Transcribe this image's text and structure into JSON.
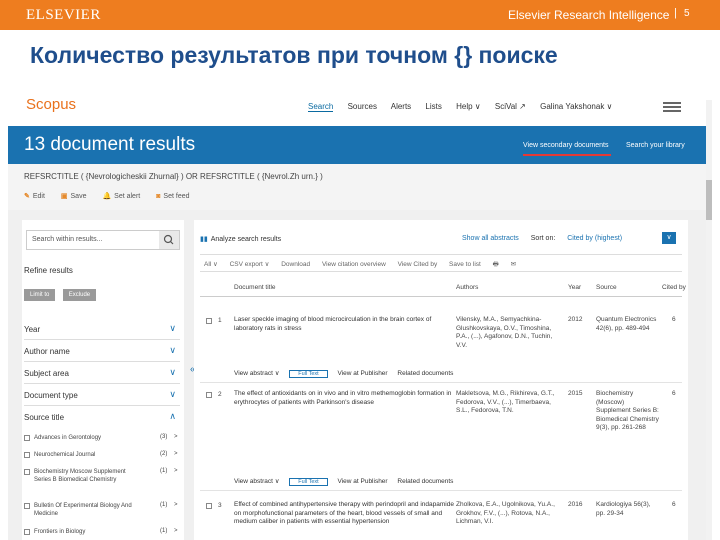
{
  "slide": {
    "title": "Количество результатов при точном {} поиске",
    "publisher_logo": "ELSEVIER",
    "product": "Elsevier Research Intelligence",
    "separator": "|",
    "page_number": "5"
  },
  "scopus": {
    "logo": "Scopus",
    "nav": [
      "Search",
      "Sources",
      "Alerts",
      "Lists",
      "Help ∨",
      "SciVal ↗",
      "Galina Yakshonak ∨"
    ],
    "menu_icon": "hamburger-icon"
  },
  "results": {
    "count_text": "13 document results",
    "view_secondary": "View secondary documents",
    "search_library": "Search your library",
    "query": "REFSRCTITLE ( {Nevrologicheskii Zhurnal} ) OR REFSRCTITLE ( {Nevrol.Zh urn.} )",
    "actions": [
      {
        "icon": "edit-icon",
        "label": "Edit"
      },
      {
        "icon": "save-icon",
        "label": "Save"
      },
      {
        "icon": "alert-icon",
        "label": "Set alert"
      },
      {
        "icon": "rss-icon",
        "label": "Set feed"
      }
    ]
  },
  "filters": {
    "search_within_placeholder": "Search within results...",
    "refine_label": "Refine results",
    "limit_to": "Limit to",
    "exclude": "Exclude",
    "facets": [
      "Year",
      "Author name",
      "Subject area",
      "Document type",
      "Source title"
    ],
    "sources": [
      {
        "name": "Advances in Gerontology",
        "count": "(3)",
        "arrow": ">"
      },
      {
        "name": "Neurochemical Journal",
        "count": "(2)",
        "arrow": ">"
      },
      {
        "name": "Biochemistry Moscow Supplement Series B Biomedical Chemistry",
        "count": "(1)",
        "arrow": ">"
      },
      {
        "name": "Bulletin Of Experimental Biology And Medicine",
        "count": "(1)",
        "arrow": ">"
      },
      {
        "name": "Frontiers in Biology",
        "count": "(1)",
        "arrow": ">"
      }
    ]
  },
  "toolbar": {
    "analyze": "Analyze search results",
    "show_all_abstracts": "Show all abstracts",
    "sort_on": "Sort on:",
    "cited_by": "Cited by (highest)",
    "sort_arrow": "∨",
    "row2": [
      "All ∨",
      "CSV export ∨",
      "Download",
      "View citation overview",
      "View Cited by",
      "Save to list",
      "🖶",
      "✉"
    ]
  },
  "columns": [
    "Document title",
    "Authors",
    "Year",
    "Source",
    "Cited by"
  ],
  "rows": [
    {
      "num": "1",
      "title": "Laser speckle imaging of blood microcirculation in the brain cortex of laboratory rats in stress",
      "authors": "Vilensky, M.A., Semyachkina-Glushkovskaya, O.V., Timoshina, P.A., (...), Agafonov, D.N., Tuchin, V.V.",
      "year": "2012",
      "source": "Quantum Electronics 42(6), pp. 489-494",
      "cited": "6"
    },
    {
      "num": "2",
      "title": "The effect of antioxidants on in vivo and in vitro methemoglobin formation in erythrocytes of patients with Parkinson's disease",
      "authors": "Makletsova, M.G., Rikhireva, G.T., Fedorova, V.V., (...), Timerbaeva, S.L., Fedorova, T.N.",
      "year": "2015",
      "source": "Biochemistry (Moscow) Supplement Series B: Biomedical Chemistry 9(3), pp. 261-268",
      "cited": "6"
    },
    {
      "num": "3",
      "title": "Effect of combined antihypertensive therapy with perindopril and indapamide on morphofunctional parameters of the heart, blood vessels of small and medium caliber in patients with essential hypertension",
      "authors": "Zholkova, E.A., Ugolnikova, Yu.A., Grokhov, F.V., (...), Rotova, N.A., Lichman, V.I.",
      "year": "2016",
      "source": "Kardiologiya 56(3), pp. 29-34",
      "cited": "6"
    }
  ],
  "row_links": {
    "view_abstract": "View abstract ∨",
    "full_text": "Full Text",
    "view_at_publisher": "View at Publisher",
    "related": "Related documents"
  }
}
